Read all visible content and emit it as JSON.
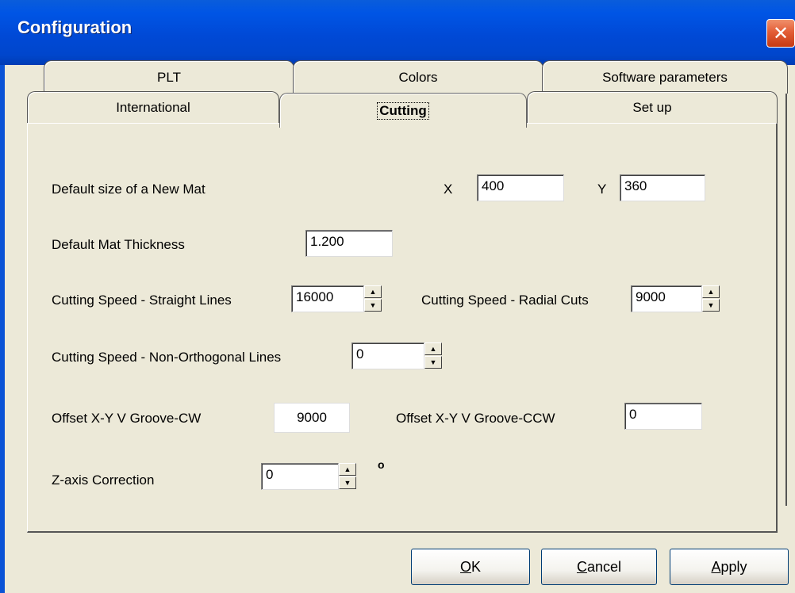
{
  "window": {
    "title": "Configuration",
    "close_label": "✕"
  },
  "tabs": {
    "back_row": [
      "PLT",
      "Colors",
      "Software parameters"
    ],
    "front_row": [
      "International",
      "Cutting",
      "Set up"
    ],
    "active": "Cutting"
  },
  "form": {
    "new_mat_label": "Default size of a New Mat",
    "x_label": "X",
    "x_value": "400",
    "y_label": "Y",
    "y_value": "360",
    "thickness_label": "Default Mat Thickness",
    "thickness_value": "1.200",
    "speed_straight_label": "Cutting Speed - Straight Lines",
    "speed_straight_value": "16000",
    "speed_radial_label": "Cutting Speed - Radial Cuts",
    "speed_radial_value": "9000",
    "speed_nonortho_label": "Cutting Speed - Non-Orthogonal Lines",
    "speed_nonortho_value": "0",
    "offset_cw_label": "Offset X-Y  V Groove-CW",
    "offset_cw_value": "9000",
    "offset_ccw_label": "Offset X-Y  V Groove-CCW",
    "offset_ccw_value": "0",
    "zaxis_label": "Z-axis Correction",
    "zaxis_value": "0",
    "degree_symbol": "o"
  },
  "buttons": {
    "ok_mnemonic": "O",
    "ok_rest": "K",
    "cancel_mnemonic": "C",
    "cancel_rest": "ancel",
    "apply_mnemonic": "A",
    "apply_rest": "pply"
  },
  "colors": {
    "title_bar": "#0055e5",
    "dialog_bg": "#ece9d8",
    "close_red": "#e35d36"
  }
}
